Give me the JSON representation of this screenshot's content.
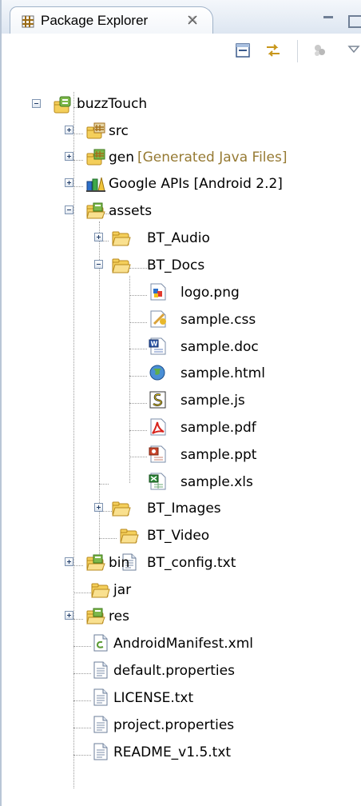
{
  "view": {
    "title": "Package Explorer"
  },
  "tree": {
    "project": {
      "label": "buzzTouch"
    },
    "items": {
      "src": "src",
      "gen": "gen",
      "gen_note": "[Generated Java Files]",
      "google_apis": "Google APIs [Android 2.2]",
      "assets": "assets",
      "bt_audio": "BT_Audio",
      "bt_docs": "BT_Docs",
      "logo_png": "logo.png",
      "sample_css": "sample.css",
      "sample_doc": "sample.doc",
      "sample_html": "sample.html",
      "sample_js": "sample.js",
      "sample_pdf": "sample.pdf",
      "sample_ppt": "sample.ppt",
      "sample_xls": "sample.xls",
      "bt_images": "BT_Images",
      "bt_video": "BT_Video",
      "bt_config": "BT_config.txt",
      "bin": "bin",
      "jar": "jar",
      "res": "res",
      "manifest": "AndroidManifest.xml",
      "default_props": "default.properties",
      "license": "LICENSE.txt",
      "project_props": "project.properties",
      "readme": "README_v1.5.txt"
    }
  },
  "icons": {
    "view_tab": "package-explorer-icon",
    "close": "close-icon",
    "collapse_all": "collapse-all-icon",
    "link_editor": "link-with-editor-icon",
    "view_menu": "view-menu-icon",
    "project": "android-project-icon",
    "source_folder": "source-folder-icon",
    "folder": "folder-icon",
    "library": "library-icon",
    "text_file": "text-file-icon"
  },
  "colors": {
    "tab_border": "#9fb2c8",
    "decoration_text": "#967a33",
    "folder_yellow": "#f4cf5b"
  }
}
